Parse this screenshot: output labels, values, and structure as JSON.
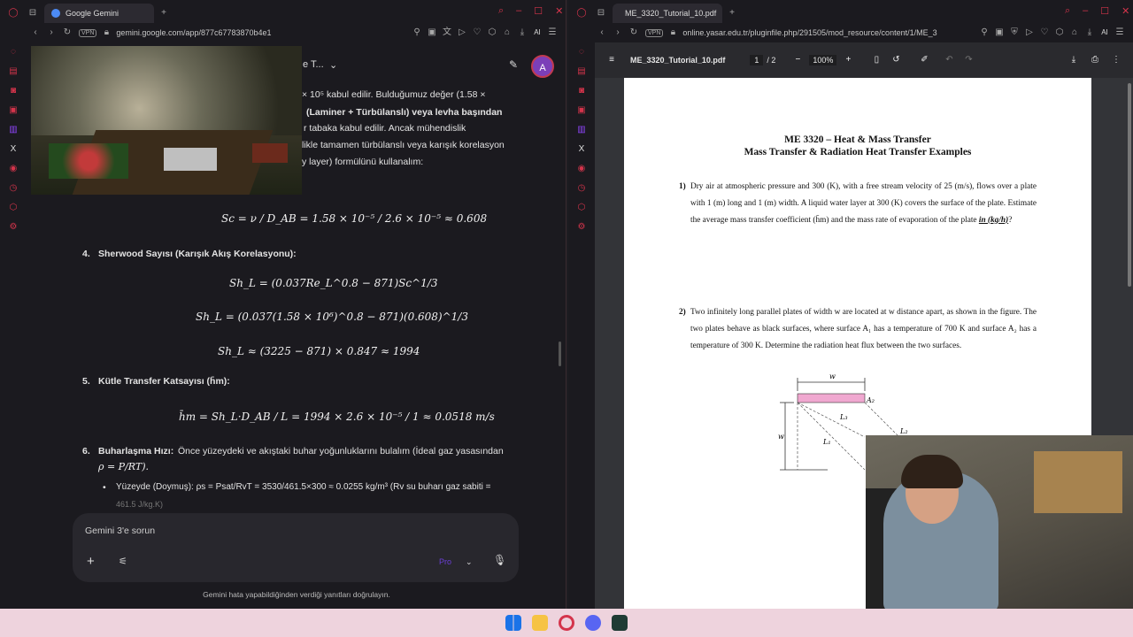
{
  "left_window": {
    "tab_title": "Google Gemini",
    "url": "gemini.google.com/app/877c67783870b4e1",
    "vpn": "VPN",
    "header_title": "e T...",
    "avatar_letter": "A",
    "text_lines": [
      "× 10⁵ kabul edilir. Bulduğumuz değer (1.58 ×",
      "(Laminer + Türbülanslı) veya levha başından",
      "r tabaka kabul edilir. Ancak mühendislik",
      "likle tamamen türbülanslı veya karışık korelasyon",
      "y layer) formülünü kullanalım:"
    ],
    "eq_sc": "Sc = ν / D_AB = 1.58 × 10⁻⁵ / 2.6 × 10⁻⁵ ≈ 0.608",
    "step4_num": "4.",
    "step4_title": "Sherwood Sayısı (Karışık Akış Korelasyonu):",
    "eq_sh1": "Sh_L = (0.037Re_L^0.8 − 871)Sc^1/3",
    "eq_sh2": "Sh_L = (0.037(1.58 × 10⁶)^0.8 − 871)(0.608)^1/3",
    "eq_sh3": "Sh_L ≈ (3225 − 871) × 0.847 ≈ 1994",
    "step5_num": "5.",
    "step5_title": "Kütle Transfer Katsayısı (h̄m):",
    "eq_hm": "h̄m = Sh_L·D_AB / L = 1994 × 2.6 × 10⁻⁵ / 1 ≈ 0.0518 m/s",
    "step6_num": "6.",
    "step6_title": "Buharlaşma Hızı:",
    "step6_text": "Önce yüzeydeki ve akıştaki buhar yoğunluklarını bulalım (İdeal gaz yasasından",
    "step6_formula": "ρ = P/RT).",
    "bullet1": "Yüzeyde (Doymuş): ρs = Psat/RvT = 3530/461.5×300 ≈ 0.0255 kg/m³ (Rv su buharı gaz sabiti =",
    "bullet1_cont": "461.5 J/kg.K)",
    "composer_placeholder": "Gemini 3'e sorun",
    "model_label": "Pro",
    "disclaimer": "Gemini hata yapabildiğinden verdiği yanıtları doğrulayın."
  },
  "right_window": {
    "tab_title": "ME_3320_Tutorial_10.pdf",
    "url": "online.yasar.edu.tr/pluginfile.php/291505/mod_resource/content/1/ME_3",
    "vpn": "VPN",
    "pdf_name": "ME_3320_Tutorial_10.pdf",
    "page_current": "1",
    "page_total": "/ 2",
    "zoom": "100%",
    "doc_title1": "ME 3320 – Heat & Mass Transfer",
    "doc_title2": "Mass Transfer & Radiation Heat Transfer Examples",
    "q1_num": "1)",
    "q1_text": "Dry air at atmospheric pressure and 300 (K), with a free stream velocity of 25 (m/s), flows over a plate with 1 (m) long and 1 (m) width. A liquid water layer at 300 (K) covers the surface of the plate. Estimate the average mass transfer coefficient (h̄m) and the mass rate of evaporation of the plate",
    "q1_unit": "in (kg/h)",
    "q1_end": "?",
    "q2_num": "2)",
    "q2_text": "Two infinitely long parallel plates of width w are located at w distance apart, as shown in the figure. The two plates behave as black surfaces, where surface A₁ has a temperature of 700 K and surface A₂ has a temperature of 300 K. Determine the radiation heat flux between the two surfaces.",
    "fig_w_top": "w",
    "fig_w_side": "w",
    "fig_a2": "A₂",
    "fig_l3": "L₃",
    "fig_l1": "L₁",
    "fig_l2": "L₂"
  },
  "colors": {
    "accent_red": "#d4344b",
    "avatar": "#7b3fb8",
    "plate_pink": "#f0a8d0"
  }
}
